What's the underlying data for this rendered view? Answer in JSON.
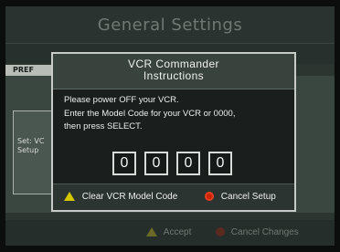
{
  "screen": {
    "title": "General Settings",
    "tab_label": "PREF",
    "background_panel_text": "Set: VC\nSetup"
  },
  "dialog": {
    "title_line1": "VCR Commander",
    "title_line2": "Instructions",
    "instructions": [
      "Please power OFF your VCR.",
      "Enter the Model Code for your VCR or 0000,",
      "then press SELECT."
    ],
    "code_digits": [
      "0",
      "0",
      "0",
      "0"
    ],
    "footer": {
      "clear_label": "Clear VCR Model Code",
      "cancel_label": "Cancel Setup"
    }
  },
  "footer": {
    "accept_label": "Accept",
    "cancel_label": "Cancel Changes"
  },
  "icons": {
    "triangle": "yellow-triangle-icon",
    "circle": "red-circle-icon"
  },
  "colors": {
    "triangle": "#d4c800",
    "circle": "#cc2200",
    "dialog_border": "#c8ccc8"
  }
}
